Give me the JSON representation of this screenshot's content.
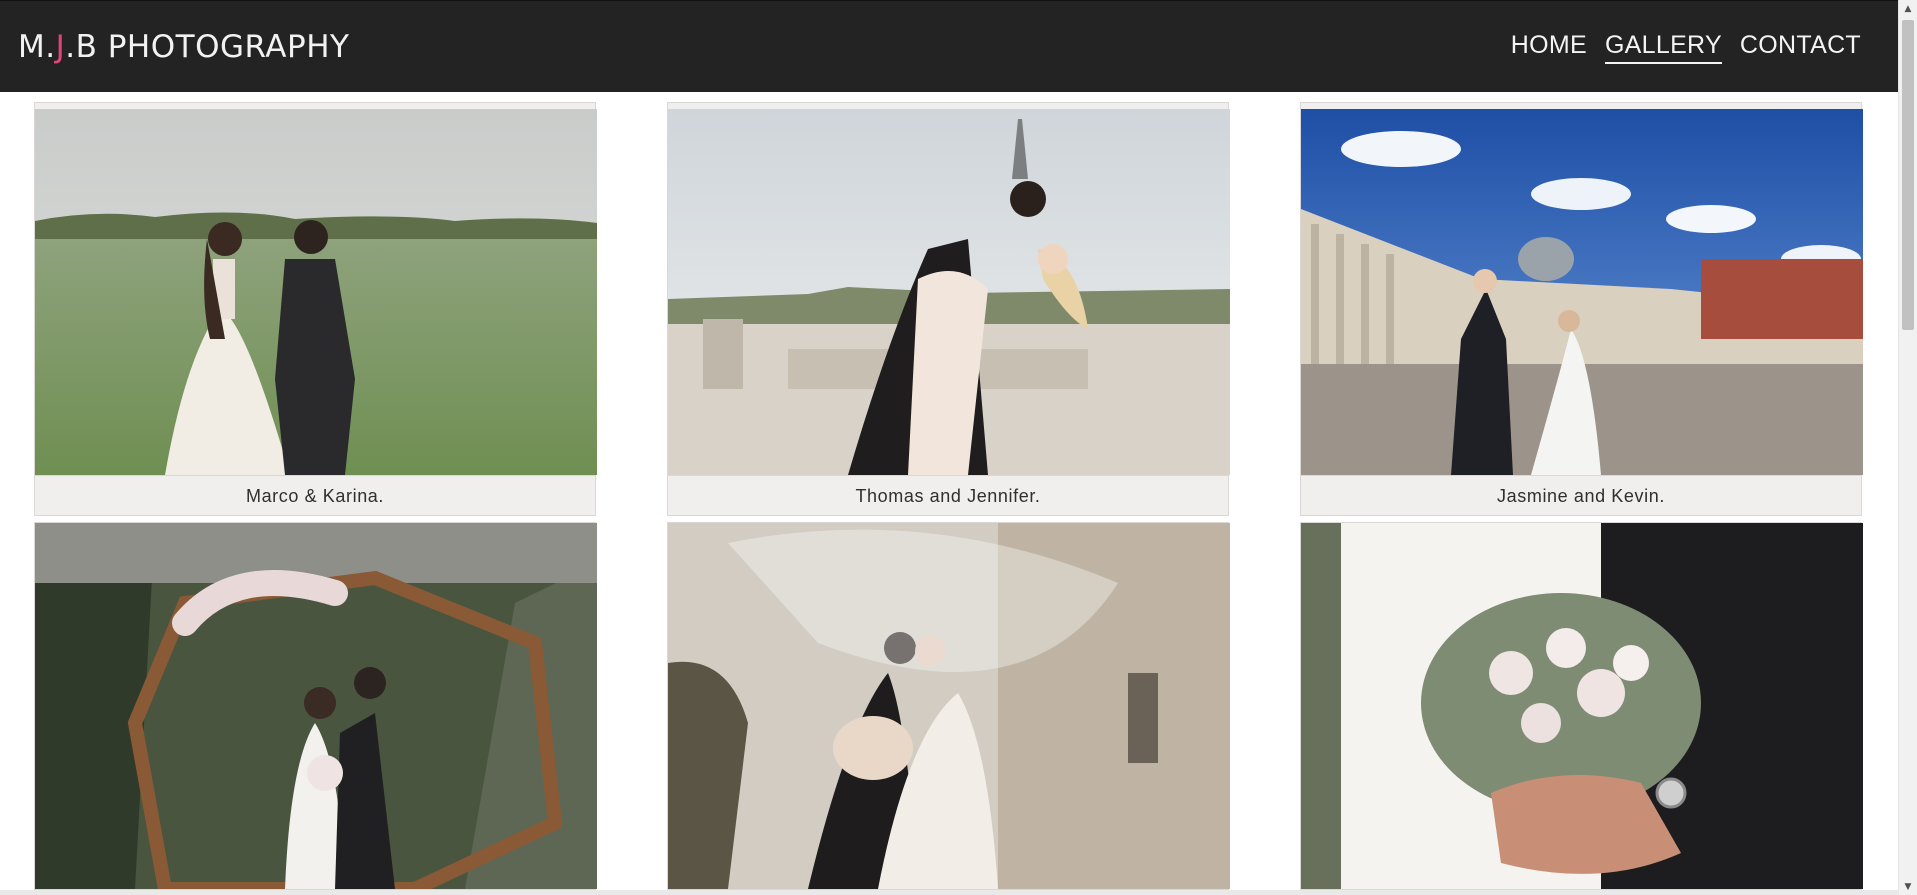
{
  "header": {
    "logo_prefix": "M.",
    "logo_accent": "J",
    "logo_suffix": ".B PHOTOGRAPHY",
    "accent_color": "#e0447a",
    "background_color": "#232323"
  },
  "nav": {
    "items": [
      {
        "label": "HOME",
        "active": false
      },
      {
        "label": "GALLERY",
        "active": true
      },
      {
        "label": "CONTACT",
        "active": false
      }
    ]
  },
  "gallery": {
    "items": [
      {
        "caption": "Marco & Karina.",
        "photo": "couple-walking-in-grass-field"
      },
      {
        "caption": "Thomas and Jennifer.",
        "photo": "couple-dip-kiss-eiffel-tower"
      },
      {
        "caption": "Jasmine and Kevin.",
        "photo": "couple-st-peters-square"
      },
      {
        "caption": "",
        "photo": "couple-kiss-floral-hexagon-arch"
      },
      {
        "caption": "",
        "photo": "couple-kiss-under-veil"
      },
      {
        "caption": "",
        "photo": "hands-holding-bouquet"
      }
    ]
  }
}
